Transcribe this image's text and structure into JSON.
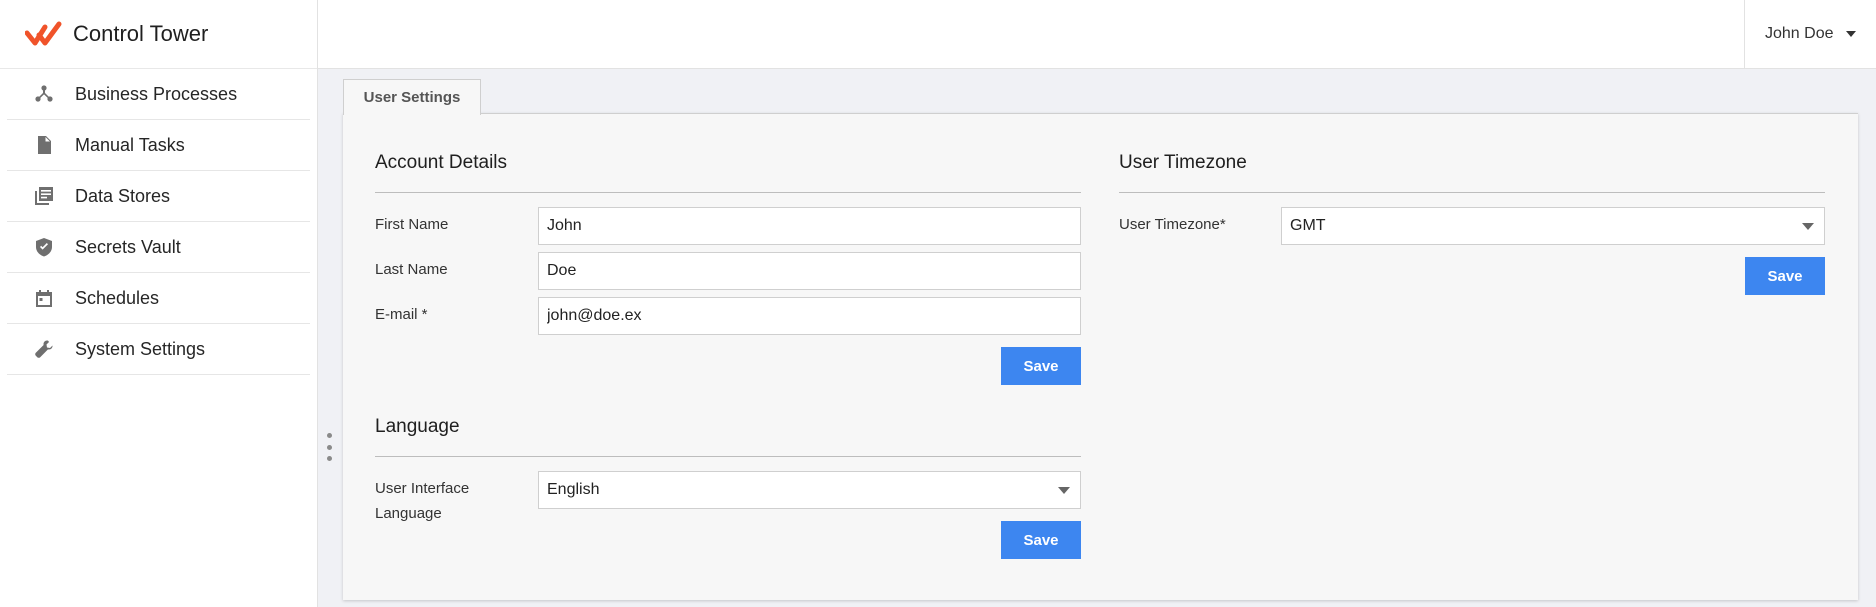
{
  "app": {
    "title": "Control Tower"
  },
  "sidebar": {
    "items": [
      {
        "label": "Business Processes",
        "icon": "flow-icon"
      },
      {
        "label": "Manual Tasks",
        "icon": "document-icon"
      },
      {
        "label": "Data Stores",
        "icon": "library-icon"
      },
      {
        "label": "Secrets Vault",
        "icon": "shield-icon"
      },
      {
        "label": "Schedules",
        "icon": "calendar-icon"
      },
      {
        "label": "System Settings",
        "icon": "wrench-icon"
      }
    ]
  },
  "header": {
    "user_name": "John Doe"
  },
  "tabs": [
    {
      "label": "User Settings"
    }
  ],
  "account": {
    "title": "Account Details",
    "first_name_label": "First Name",
    "first_name_value": "John",
    "last_name_label": "Last Name",
    "last_name_value": "Doe",
    "email_label": "E-mail *",
    "email_value": "john@doe.ex",
    "save_label": "Save"
  },
  "language": {
    "title": "Language",
    "label_line1": "User Interface",
    "label_line2": "Language",
    "selected": "English",
    "save_label": "Save"
  },
  "timezone": {
    "title": "User Timezone",
    "label": "User Timezone*",
    "selected": "GMT",
    "save_label": "Save"
  },
  "colors": {
    "accent": "#3d86f0",
    "brand": "#f0532a"
  }
}
